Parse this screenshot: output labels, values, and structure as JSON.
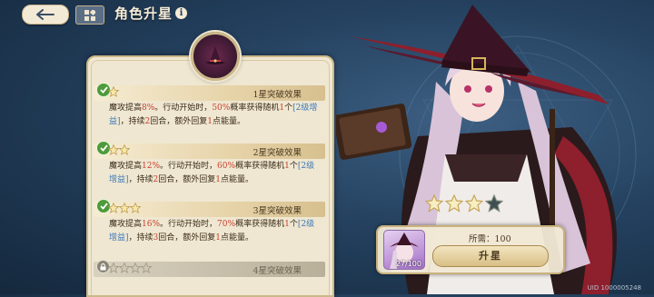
{
  "header": {
    "title": "角色升星",
    "info_label": "i"
  },
  "breakthroughs": [
    {
      "title": "1星突破效果",
      "stars": 1,
      "unlocked": true,
      "desc_parts": [
        {
          "t": "魔攻提高",
          "c": ""
        },
        {
          "t": "8%",
          "c": "hl"
        },
        {
          "t": "。行动开始时，",
          "c": ""
        },
        {
          "t": "50%",
          "c": "hl"
        },
        {
          "t": "概率获得随机",
          "c": ""
        },
        {
          "t": "1",
          "c": "hl"
        },
        {
          "t": "个",
          "c": ""
        },
        {
          "t": "[2级增益]",
          "c": "hb"
        },
        {
          "t": "，持续",
          "c": ""
        },
        {
          "t": "2",
          "c": "hl"
        },
        {
          "t": "回合，额外回复",
          "c": ""
        },
        {
          "t": "1",
          "c": "hl"
        },
        {
          "t": "点能量。",
          "c": ""
        }
      ]
    },
    {
      "title": "2星突破效果",
      "stars": 2,
      "unlocked": true,
      "desc_parts": [
        {
          "t": "魔攻提高",
          "c": ""
        },
        {
          "t": "12%",
          "c": "hl"
        },
        {
          "t": "。行动开始时，",
          "c": ""
        },
        {
          "t": "60%",
          "c": "hl"
        },
        {
          "t": "概率获得随机",
          "c": ""
        },
        {
          "t": "1",
          "c": "hl"
        },
        {
          "t": "个",
          "c": ""
        },
        {
          "t": "[2级增益]",
          "c": "hb"
        },
        {
          "t": "，持续",
          "c": ""
        },
        {
          "t": "2",
          "c": "hl"
        },
        {
          "t": "回合，额外回复",
          "c": ""
        },
        {
          "t": "1",
          "c": "hl"
        },
        {
          "t": "点能量。",
          "c": ""
        }
      ]
    },
    {
      "title": "3星突破效果",
      "stars": 3,
      "unlocked": true,
      "desc_parts": [
        {
          "t": "魔攻提高",
          "c": ""
        },
        {
          "t": "16%",
          "c": "hl"
        },
        {
          "t": "。行动开始时，",
          "c": ""
        },
        {
          "t": "70%",
          "c": "hl"
        },
        {
          "t": "概率获得随机",
          "c": ""
        },
        {
          "t": "1",
          "c": "hl"
        },
        {
          "t": "个",
          "c": ""
        },
        {
          "t": "[2级增益]",
          "c": "hb"
        },
        {
          "t": "，持续",
          "c": ""
        },
        {
          "t": "3",
          "c": "hl"
        },
        {
          "t": "回合，额外回复",
          "c": ""
        },
        {
          "t": "1",
          "c": "hl"
        },
        {
          "t": "点能量。",
          "c": ""
        }
      ]
    },
    {
      "title": "4星突破效果",
      "stars": 4,
      "unlocked": false,
      "desc_parts": []
    }
  ],
  "star_rank": {
    "filled": 3,
    "total": 4
  },
  "cost": {
    "label": "所需：100",
    "item_count": "27/100",
    "upgrade_label": "升星"
  },
  "uid": "UID 1000005248",
  "colors": {
    "highlight_red": "#c8402e",
    "highlight_blue": "#3d78b8",
    "check_green": "#4f9a3c",
    "panel_bg": "#efe7d1",
    "bg_navy": "#24415f"
  }
}
